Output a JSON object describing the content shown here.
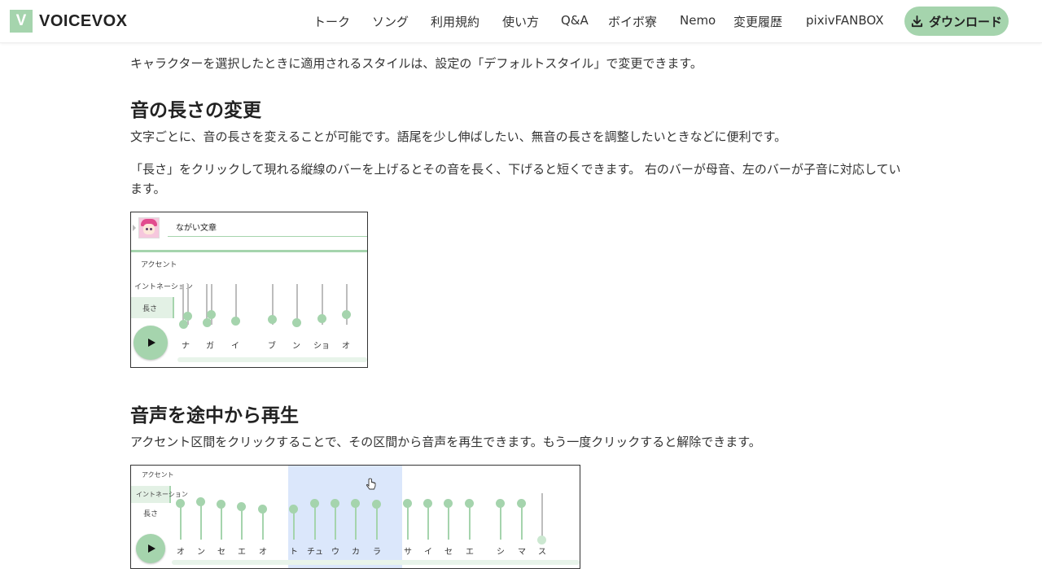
{
  "header": {
    "logo_letter": "V",
    "logo_text": "VOICEVOX",
    "nav": [
      "トーク",
      "ソング",
      "利用規約",
      "使い方",
      "Q&A",
      "ボイボ寮",
      "Nemo",
      "変更履歴",
      "pixivFANBOX"
    ],
    "download_label": "ダウンロード",
    "download_icon": "download-icon"
  },
  "content": {
    "intro": "キャラクターを選択したときに適用されるスタイルは、設定の「デフォルトスタイル」で変更できます。",
    "section1": {
      "title": "音の長さの変更",
      "p1": "文字ごとに、音の長さを変えることが可能です。語尾を少し伸ばしたい、無音の長さを調整したいときなどに便利です。",
      "p2": "「長さ」をクリックして現れる縦線のバーを上げるとその音を長く、下げると短くできます。 右のバーが母音、左のバーが子音に対応しています。"
    },
    "fig1": {
      "text": "ながい文章",
      "labels": [
        "アクセント",
        "イントネーション",
        "長さ"
      ],
      "active_label": "長さ",
      "moras": [
        "ナ",
        "ガ",
        "イ",
        "ブ",
        "ン",
        "ショ",
        "オ"
      ]
    },
    "section2": {
      "title": "音声を途中から再生",
      "p1": "アクセント区間をクリックすることで、その区間から音声を再生できます。もう一度クリックすると解除できます。"
    },
    "fig2": {
      "labels": [
        "アクセント",
        "イントネーション",
        "長さ"
      ],
      "active_label": "イントネーション",
      "moras": [
        "オ",
        "ン",
        "セ",
        "エ",
        "オ",
        "ト",
        "チュ",
        "ウ",
        "カ",
        "ラ",
        "サ",
        "イ",
        "セ",
        "エ",
        "シ",
        "マ",
        "ス"
      ]
    }
  },
  "colors": {
    "accent": "#a5d4ad",
    "highlight": "#dbe7fb",
    "text": "#333333"
  }
}
